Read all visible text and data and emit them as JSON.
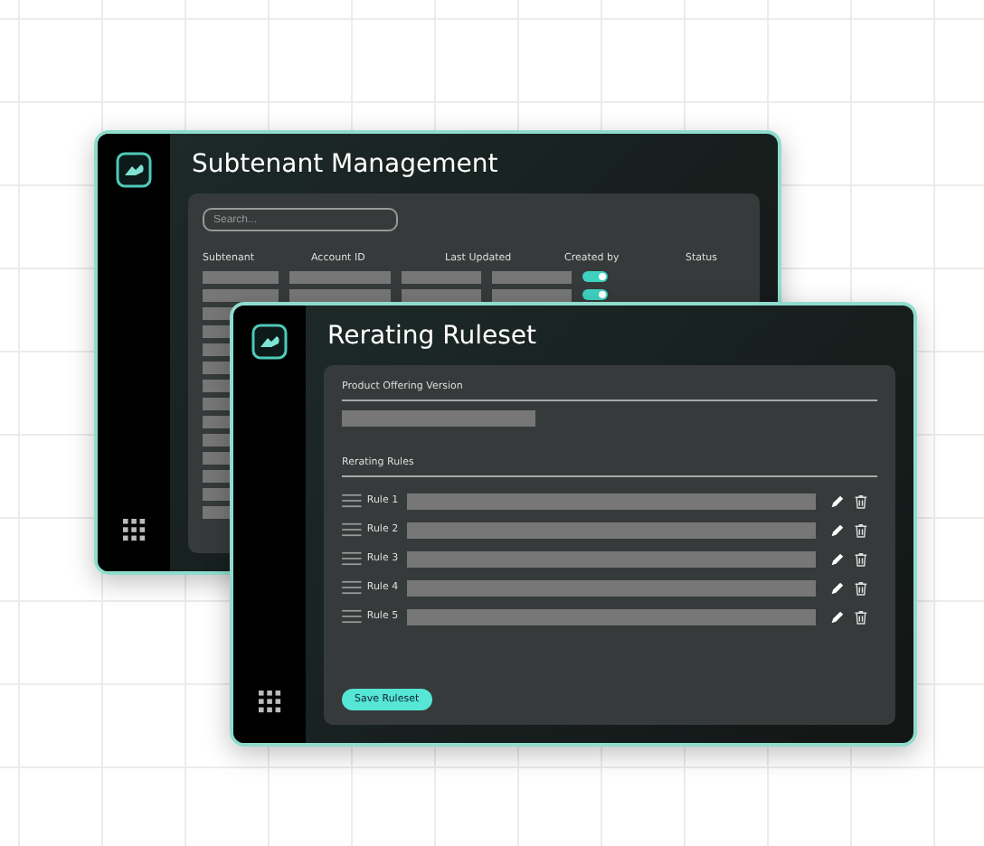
{
  "back_window": {
    "title": "Subtenant Management",
    "search": {
      "placeholder": "Search..."
    },
    "table": {
      "columns": [
        "Subtenant",
        "Account ID",
        "Last Updated",
        "Created by",
        "Status"
      ],
      "rows": [
        {
          "on": true
        },
        {
          "on": true
        },
        {},
        {},
        {},
        {},
        {},
        {},
        {},
        {},
        {},
        {},
        {},
        {}
      ]
    }
  },
  "front_window": {
    "title": "Rerating Ruleset",
    "product_label": "Product Offering Version",
    "rules_label": "Rerating Rules",
    "rules": [
      {
        "label": "Rule 1"
      },
      {
        "label": "Rule 2"
      },
      {
        "label": "Rule 3"
      },
      {
        "label": "Rule 4"
      },
      {
        "label": "Rule 5"
      }
    ],
    "save_button": "Save Ruleset"
  }
}
